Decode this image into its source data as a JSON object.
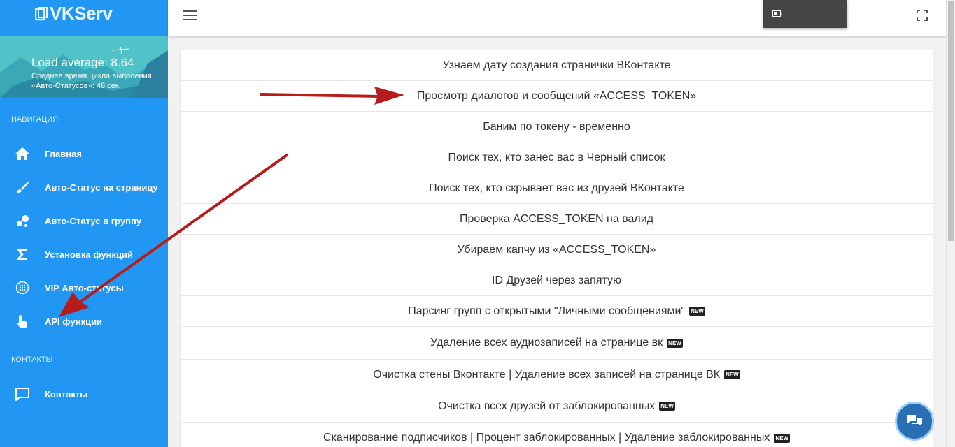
{
  "brand": {
    "logo_text": "VKServ"
  },
  "hero": {
    "load_average": "Load average: 8.64",
    "cycle_text": "Среднее время цикла выполения «Авто-Статусов»: 48 сек."
  },
  "sidebar": {
    "nav_header": "НАВИГАЦИЯ",
    "items": [
      {
        "label": "Главная",
        "icon": "home-icon"
      },
      {
        "label": "Авто-Статус на страницу",
        "icon": "brush-icon"
      },
      {
        "label": "Авто-Статус в группу",
        "icon": "bubbles-icon"
      },
      {
        "label": "Установка функций",
        "icon": "sigma-icon"
      },
      {
        "label": "VIP Авто-статусы",
        "icon": "globe-icon"
      },
      {
        "label": "API функции",
        "icon": "touch-icon"
      }
    ],
    "contacts_header": "КОНТАКТЫ",
    "contacts": {
      "label": "Контакты",
      "icon": "chat-icon"
    }
  },
  "list": {
    "items": [
      {
        "label": "Узнаем дату создания странички ВКонтакте",
        "new": false
      },
      {
        "label": "Просмотр диалогов и сообщений «ACCESS_TOKEN»",
        "new": false
      },
      {
        "label": "Баним по токену - временно",
        "new": false
      },
      {
        "label": "Поиск тех, кто занес вас в Черный список",
        "new": false
      },
      {
        "label": "Поиск тех, кто скрывает вас из друзей ВКонтакте",
        "new": false
      },
      {
        "label": "Проверка ACCESS_TOKEN на валид",
        "new": false
      },
      {
        "label": "Убираем капчу из «ACCESS_TOKEN»",
        "new": false
      },
      {
        "label": "ID Друзей через запятую",
        "new": false
      },
      {
        "label": "Парсинг групп с открытыми \"Личными сообщениями\"",
        "new": true
      },
      {
        "label": "Удаление всех аудиозаписей на странице вк",
        "new": true
      },
      {
        "label": "Очистка стены Вконтакте | Удаление всех записей на странице ВК",
        "new": true
      },
      {
        "label": "Очистка всех друзей от заблокированных",
        "new": true
      },
      {
        "label": "Сканирование подписчиков | Процент заблокированных | Удаление заблокированных",
        "new": true
      }
    ],
    "new_badge_text": "NEW"
  },
  "colors": {
    "sidebar": "#2196f3",
    "hero": "#4fc3c7",
    "arrow": "#b71c1c",
    "chat_button": "#2a6fb3"
  }
}
